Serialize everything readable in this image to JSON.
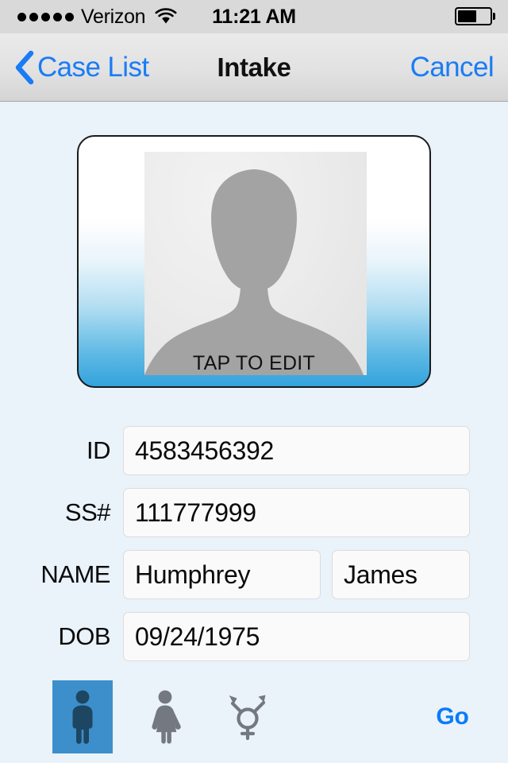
{
  "status_bar": {
    "carrier": "Verizon",
    "signal_dots_filled": 5,
    "signal_dots_total": 5,
    "wifi_icon": "wifi-icon",
    "time": "11:21 AM",
    "battery_icon": "battery-icon",
    "battery_level_percent": 60
  },
  "nav_bar": {
    "back_icon": "chevron-left-icon",
    "back_label": "Case List",
    "title": "Intake",
    "cancel_label": "Cancel"
  },
  "photo_card": {
    "avatar_icon": "person-silhouette-icon",
    "tap_to_edit_label": "TAP TO EDIT"
  },
  "form": {
    "rows": [
      {
        "label": "ID",
        "value": "4583456392"
      },
      {
        "label": "SS#",
        "value": "111777999"
      },
      {
        "label": "NAME",
        "value": "Humphrey",
        "value2": "James"
      },
      {
        "label": "DOB",
        "value": "09/24/1975"
      }
    ]
  },
  "gender": {
    "options": [
      {
        "name": "male",
        "icon": "male-figure-icon",
        "selected": true
      },
      {
        "name": "female",
        "icon": "female-figure-icon",
        "selected": false
      },
      {
        "name": "transgender",
        "icon": "transgender-symbol-icon",
        "selected": false
      }
    ],
    "selected": "male"
  },
  "actions": {
    "go_label": "Go"
  },
  "colors": {
    "accent_blue": "#0a7cf7",
    "link_blue": "#1a7cf5",
    "selected_blue": "#3d8fcb",
    "page_background": "#eaf2fa",
    "card_gradient_bottom": "#33a3dd",
    "icon_gray": "#74797f",
    "icon_selected_navy": "#1d4662"
  }
}
